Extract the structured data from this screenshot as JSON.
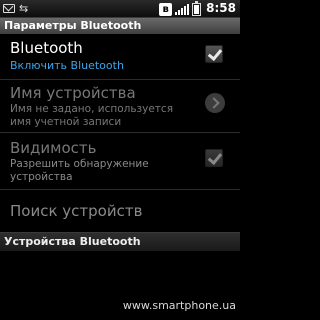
{
  "status_bar": {
    "time": "8:58",
    "icons": [
      "message-icon",
      "usb-icon",
      "bluetooth-icon",
      "signal-icon",
      "battery-icon"
    ]
  },
  "header": {
    "title": "Параметры Bluetooth"
  },
  "settings": {
    "bluetooth": {
      "title": "Bluetooth",
      "subtitle": "Включить Bluetooth",
      "checked": true
    },
    "device_name": {
      "title": "Имя устройства",
      "subtitle_line1": "Имя не задано, используется",
      "subtitle_line2": "имя учетной записи"
    },
    "visibility": {
      "title": "Видимость",
      "subtitle_line1": "Разрешить обнаружение",
      "subtitle_line2": "устройства",
      "checked": true
    },
    "scan": {
      "title": "Поиск устройств"
    }
  },
  "devices_section": {
    "title": "Устройства Bluetooth"
  },
  "watermark": "www.smartphone.ua",
  "colors": {
    "accent_blue": "#3aa6e8",
    "disabled_text": "#777777"
  }
}
